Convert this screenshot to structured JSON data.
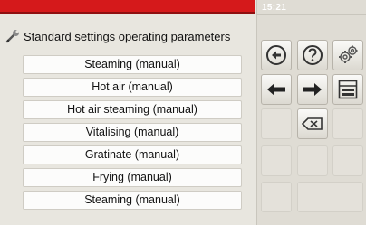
{
  "status": {
    "time": "15:21"
  },
  "header": {
    "title": "Standard settings operating parameters",
    "icon": "wrench-icon"
  },
  "menu": {
    "items": [
      "Steaming (manual)",
      "Hot air (manual)",
      "Hot air steaming (manual)",
      "Vitalising (manual)",
      "Gratinate (manual)",
      "Frying (manual)",
      "Steaming (manual)"
    ]
  },
  "toolbar": {
    "buttons": [
      "back-icon",
      "help-icon",
      "settings-icon",
      "arrow-left-icon",
      "arrow-right-icon",
      "save-icon",
      "backspace-icon"
    ]
  },
  "colors": {
    "accent_red": "#d5191b",
    "panel": "#e6e3db"
  }
}
